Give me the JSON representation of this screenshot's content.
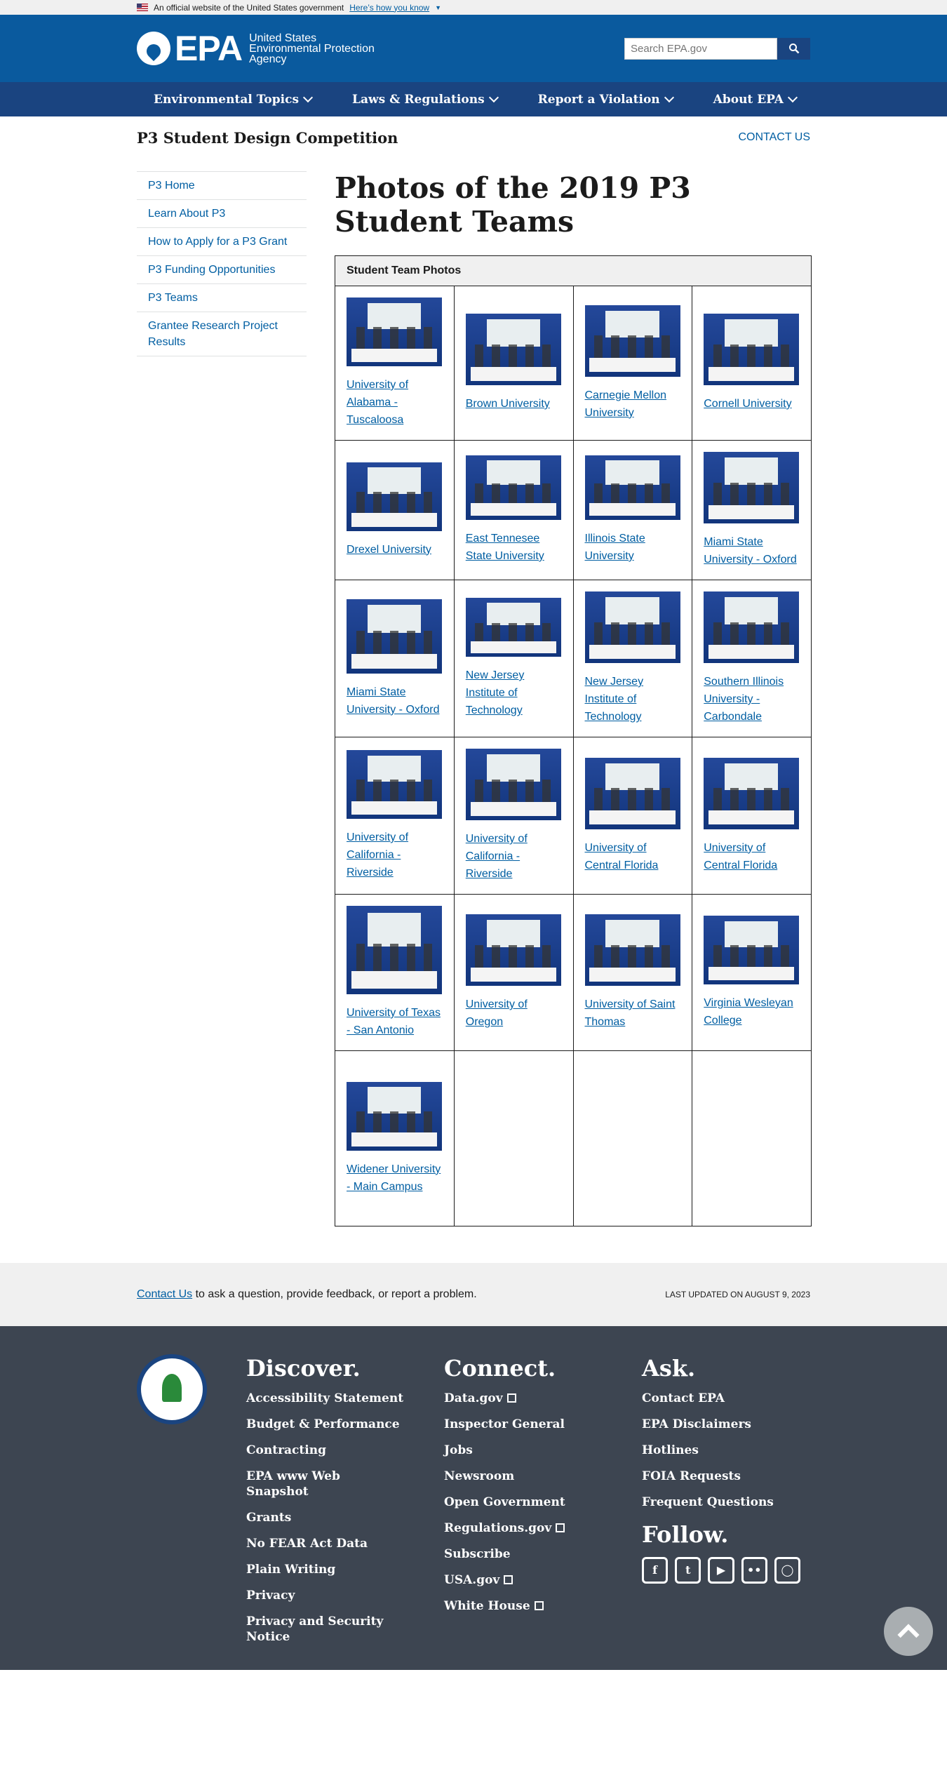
{
  "gov_banner": {
    "text": "An official website of the United States government",
    "link": "Here’s how you know"
  },
  "header": {
    "logo_text": "EPA",
    "agency": [
      "United States",
      "Environmental Protection",
      "Agency"
    ],
    "search_placeholder": "Search EPA.gov"
  },
  "nav": [
    "Environmental Topics",
    "Laws & Regulations",
    "Report a Violation",
    "About EPA"
  ],
  "site_title": "P3 Student Design Competition",
  "contact_us": "CONTACT US",
  "sidebar": [
    "P3 Home",
    "Learn About P3",
    "How to Apply for a P3 Grant",
    "P3 Funding Opportunities",
    "P3 Teams",
    "Grantee Research Project Results"
  ],
  "page_title": "Photos of the 2019 P3 Student Teams",
  "table_header": "Student Team Photos",
  "teams": [
    "University of Alabama - Tuscaloosa",
    "Brown University",
    "Carnegie Mellon University",
    "Cornell University",
    "Drexel University",
    "East Tennesee State University",
    "Illinois State University",
    "Miami State University - Oxford",
    "Miami State University - Oxford",
    "New Jersey Institute of Technology",
    "New Jersey Institute of Technology",
    "Southern Illinois University - Carbondale",
    "University of California - Riverside",
    "University of California - Riverside",
    "University of Central Florida",
    "University of Central Florida",
    "University of Texas - San Antonio",
    "University of Oregon",
    "University of Saint Thomas",
    "Virginia Wesleyan College",
    "Widener University - Main Campus"
  ],
  "footer_bar": {
    "contact_link": "Contact Us",
    "contact_text": " to ask a question, provide feedback, or report a problem.",
    "updated": "LAST UPDATED ON AUGUST 9, 2023"
  },
  "footer": {
    "discover": {
      "title": "Discover.",
      "items": [
        "Accessibility Statement",
        "Budget & Performance",
        "Contracting",
        "EPA www Web Snapshot",
        "Grants",
        "No FEAR Act Data",
        "Plain Writing",
        "Privacy",
        "Privacy and Security Notice"
      ]
    },
    "connect": {
      "title": "Connect.",
      "items": [
        "Data.gov",
        "Inspector General",
        "Jobs",
        "Newsroom",
        "Open Government",
        "Regulations.gov",
        "Subscribe",
        "USA.gov",
        "White House"
      ],
      "external": [
        true,
        false,
        false,
        false,
        false,
        true,
        false,
        true,
        true
      ]
    },
    "ask": {
      "title": "Ask.",
      "items": [
        "Contact EPA",
        "EPA Disclaimers",
        "Hotlines",
        "FOIA Requests",
        "Frequent Questions"
      ]
    },
    "follow": {
      "title": "Follow.",
      "icons": [
        "facebook-icon",
        "twitter-icon",
        "youtube-icon",
        "flickr-icon",
        "instagram-icon"
      ]
    }
  }
}
